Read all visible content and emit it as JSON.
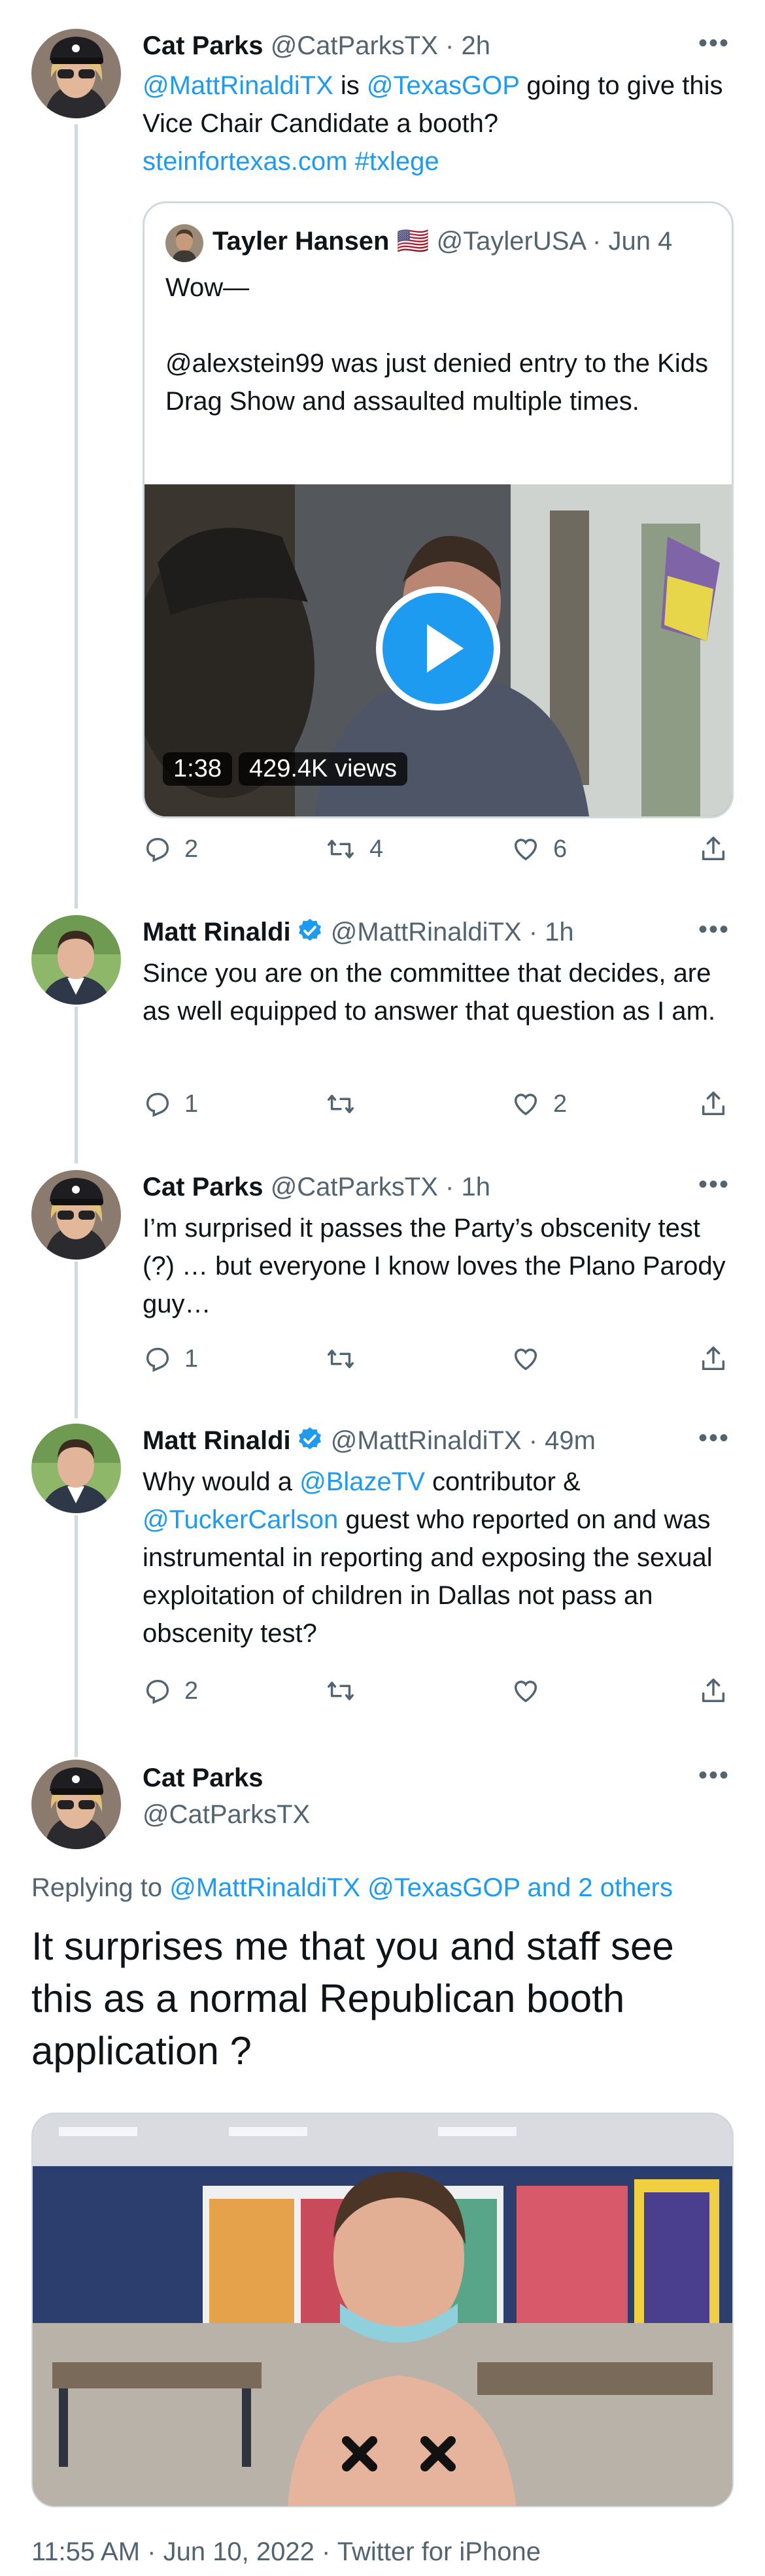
{
  "tweets": [
    {
      "name": "Cat Parks",
      "handle": "@CatParksTX",
      "time": "· 2h",
      "text_mention1": "@MattRinaldiTX",
      "text_is": " is ",
      "text_mention2": "@TexasGOP",
      "text_rest": " going to give this Vice Chair Candidate a booth?",
      "text_link": "steinfortexas.com",
      "text_hashtag": "#txlege",
      "quote": {
        "name": "Tayler Hansen",
        "flag": "🇺🇸",
        "handle": "@TaylerUSA",
        "time": "· Jun 4",
        "text1": "Wow—",
        "text2": "@alexstein99 was just denied entry to the Kids Drag Show and assaulted multiple times.",
        "video_duration": "1:38",
        "video_views": "429.4K views"
      },
      "replies": "2",
      "retweets": "4",
      "likes": "6"
    },
    {
      "name": "Matt Rinaldi",
      "handle": "@MattRinaldiTX",
      "time": "· 1h",
      "text": "Since you are on the committee that decides, are as well equipped to answer that question as I am.",
      "replies": "1",
      "retweets": "",
      "likes": "2"
    },
    {
      "name": "Cat Parks",
      "handle": "@CatParksTX",
      "time": "· 1h",
      "text": "I’m surprised it passes the Party’s obscenity test (?) … but everyone I know loves the Plano Parody guy…",
      "replies": "1",
      "retweets": "",
      "likes": ""
    },
    {
      "name": "Matt Rinaldi",
      "handle": "@MattRinaldiTX",
      "time": "· 49m",
      "text_pre": "Why would a ",
      "text_mention1": "@BlazeTV",
      "text_mid": " contributor &",
      "text_mention2": "@TuckerCarlson",
      "text_rest": " guest who reported on and was instrumental in reporting and exposing the sexual exploitation of children in Dallas not pass an obscenity test?",
      "replies": "2",
      "retweets": "",
      "likes": ""
    }
  ],
  "main_tweet": {
    "name": "Cat Parks",
    "handle": "@CatParksTX",
    "replying_label": "Replying to",
    "replying_to": "@MattRinaldiTX @TexasGOP and 2 others",
    "text": "It surprises me that you and staff see this as a normal Republican booth application ?",
    "timestamp": "11:55 AM · Jun 10, 2022 · Twitter for iPhone"
  },
  "more_glyph": "•••",
  "colors": {
    "link": "#1d9bf0",
    "muted": "#536471",
    "border": "#cfd9de"
  }
}
